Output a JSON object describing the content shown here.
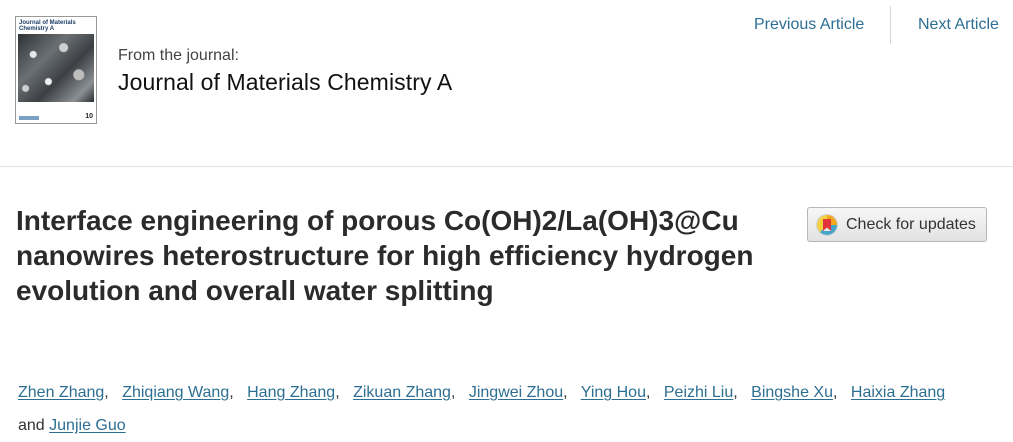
{
  "journal": {
    "cover_title": "Journal of Materials Chemistry A",
    "cover_logo": "10",
    "from_label": "From the journal:",
    "name": "Journal of Materials Chemistry A"
  },
  "nav": {
    "previous": "Previous Article",
    "next": "Next Article"
  },
  "article": {
    "title": "Interface engineering of porous Co(OH)2/La(OH)3@Cu nanowires heterostructure for high efficiency hydrogen evolution and overall water splitting"
  },
  "check_updates": {
    "label": "Check for updates",
    "icon": "crossmark-icon"
  },
  "authors": {
    "names": [
      "Zhen Zhang",
      "Zhiqiang Wang",
      "Hang Zhang",
      "Zikuan Zhang",
      "Jingwei Zhou",
      "Ying Hou",
      "Peizhi Liu",
      "Bingshe Xu",
      "Haixia Zhang",
      "Junjie Guo"
    ],
    "separator": ",",
    "conjunction": "and"
  },
  "colors": {
    "link": "#2d6f93",
    "title": "#2b2b2b"
  }
}
